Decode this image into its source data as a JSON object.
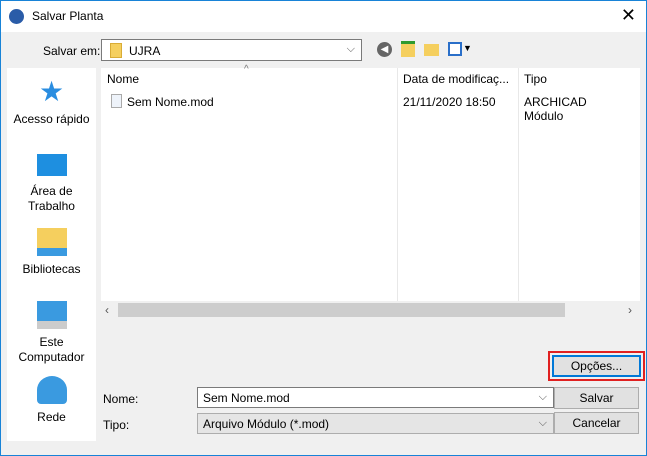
{
  "window": {
    "title": "Salvar Planta",
    "close": "✕"
  },
  "location": {
    "label": "Salvar em:",
    "value": "UJRA"
  },
  "sidebar": [
    {
      "label": "Acesso rápido"
    },
    {
      "label": "Área de Trabalho"
    },
    {
      "label": "Bibliotecas"
    },
    {
      "label": "Este Computador"
    },
    {
      "label": "Rede"
    }
  ],
  "columns": [
    "Nome",
    "Data de modificaç...",
    "Tipo"
  ],
  "files": [
    {
      "name": "Sem Nome.mod",
      "date": "21/11/2020 18:50",
      "type": "ARCHICAD Módulo"
    }
  ],
  "options_button": "Opções...",
  "name_field": {
    "label": "Nome:",
    "value": "Sem Nome.mod"
  },
  "type_field": {
    "label": "Tipo:",
    "value": "Arquivo Módulo (*.mod)"
  },
  "save_button": "Salvar",
  "cancel_button": "Cancelar"
}
